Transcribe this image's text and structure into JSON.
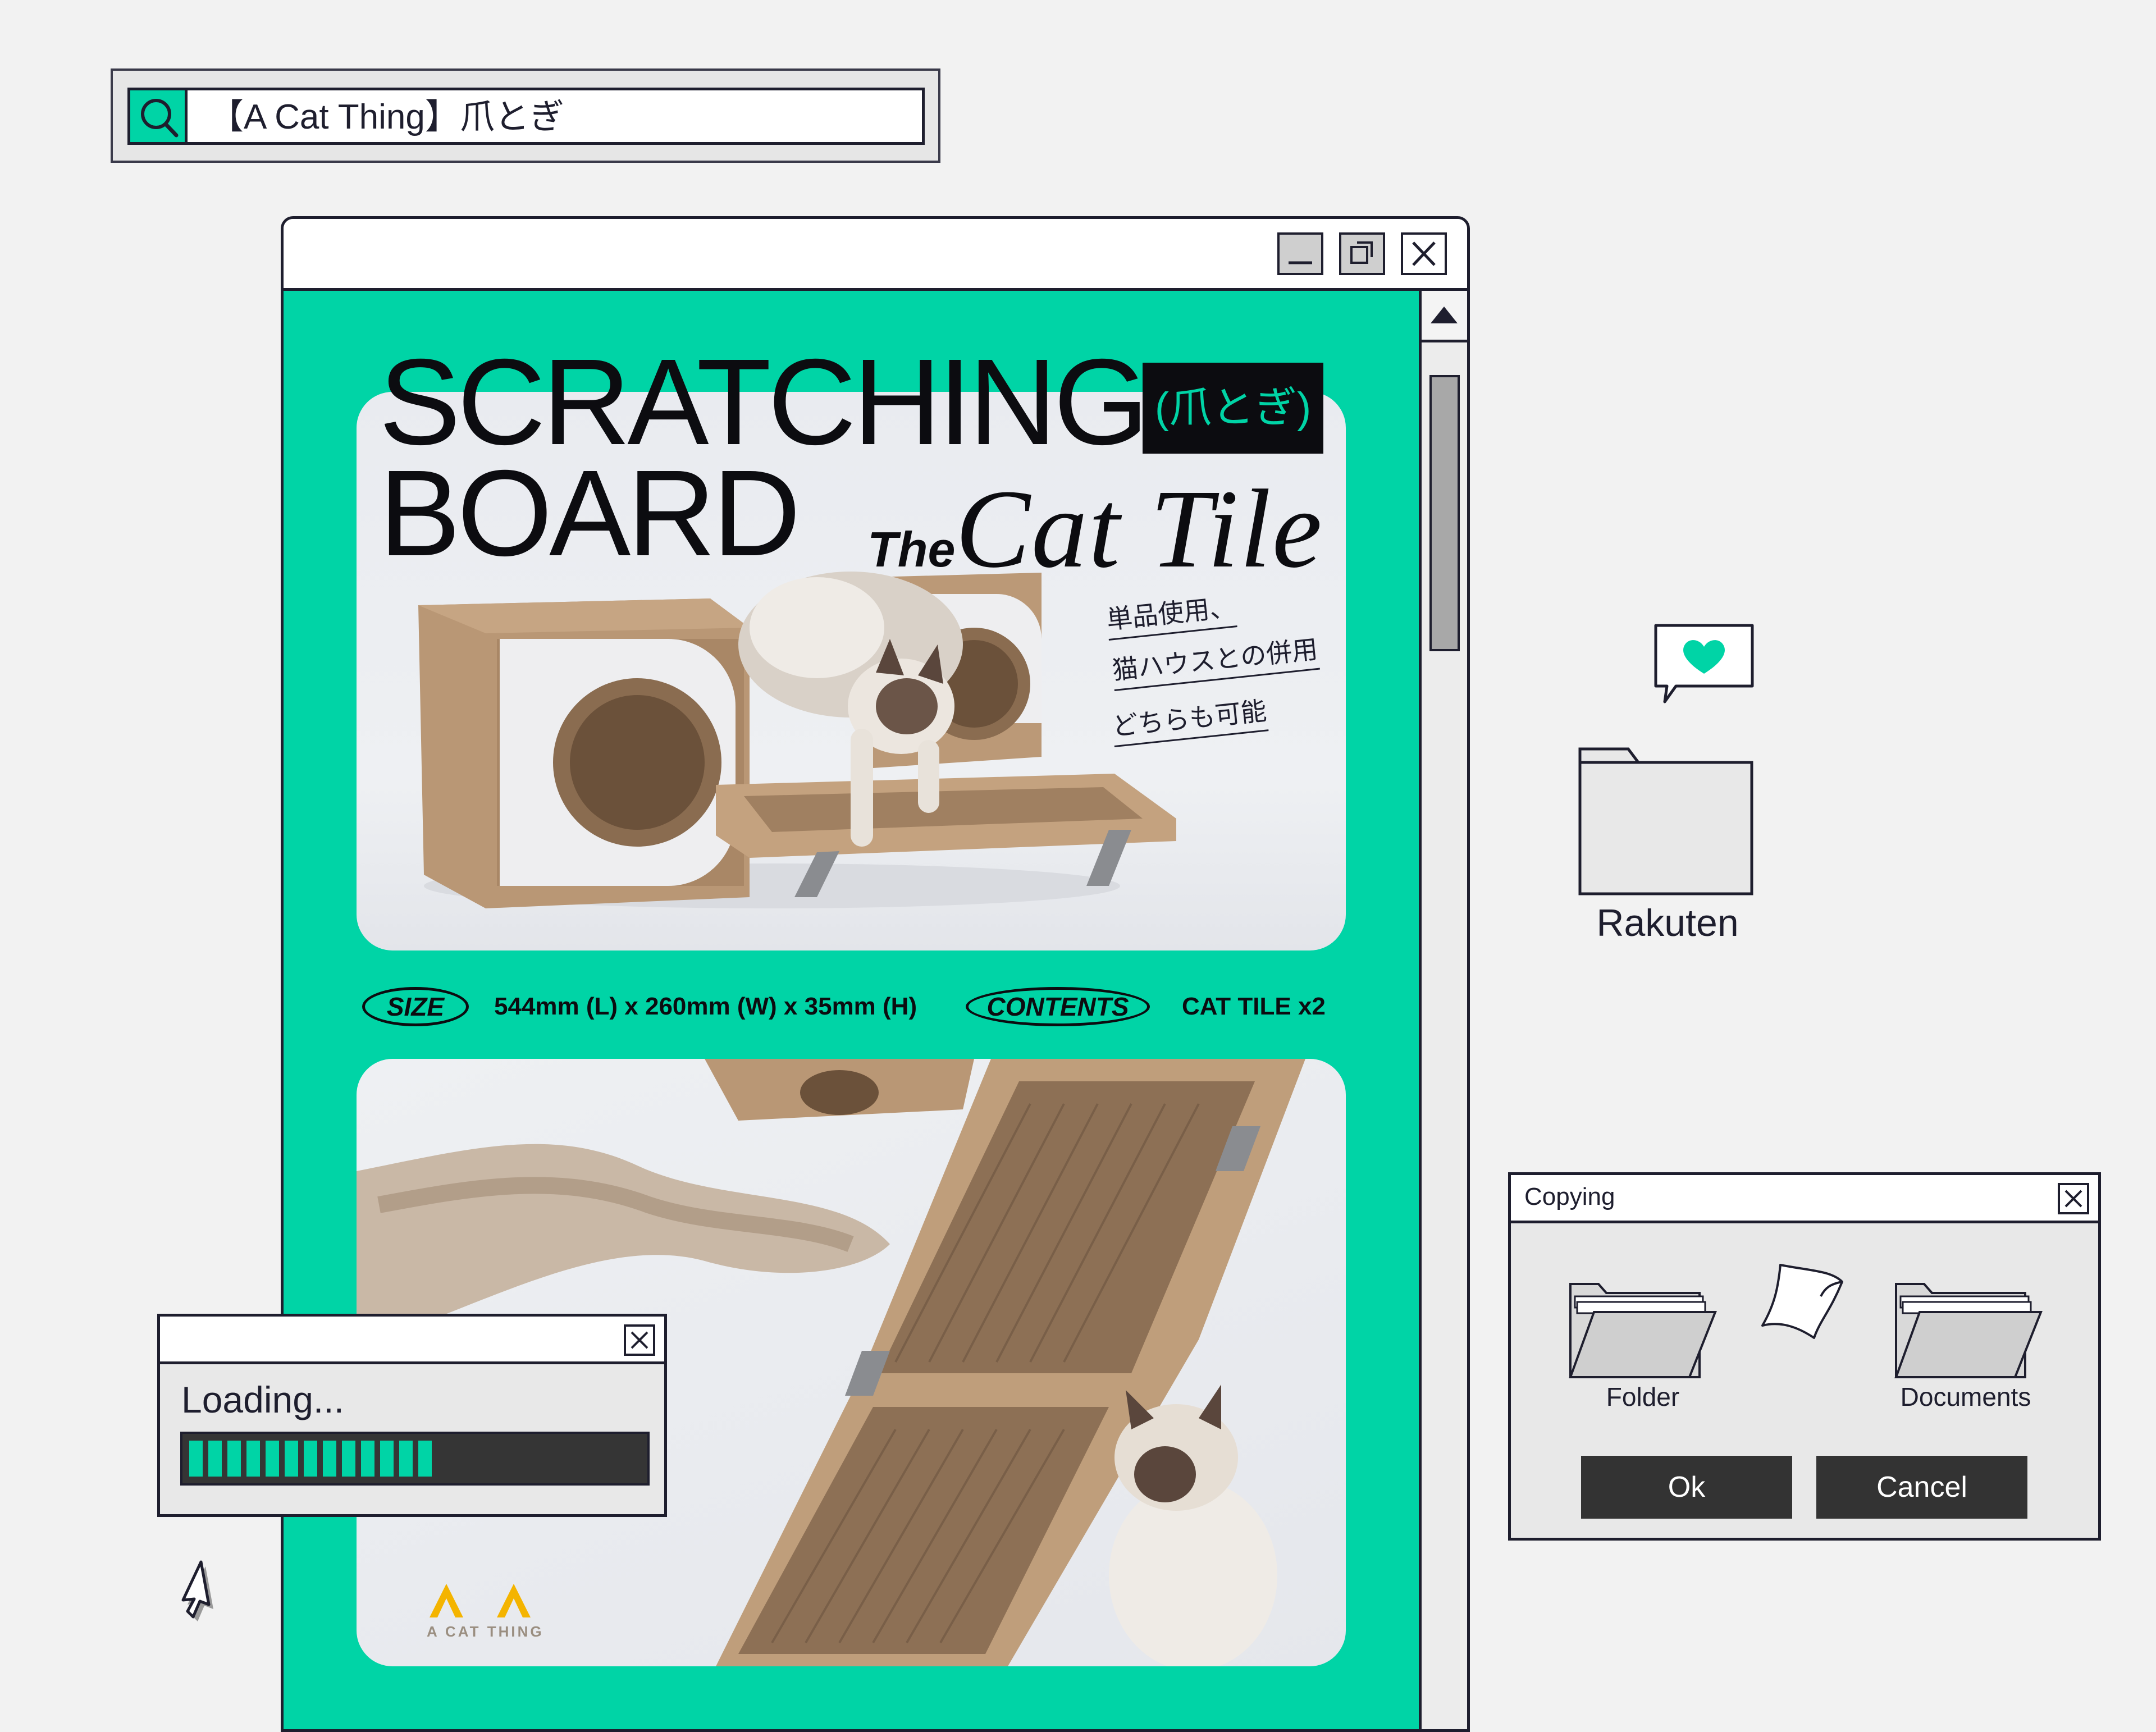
{
  "search": {
    "query": "【A Cat Thing】爪とぎ",
    "icon": "search-icon",
    "accent": "#00d4a6"
  },
  "main_window": {
    "controls": [
      "minimize-icon",
      "restore-icon",
      "close-icon"
    ],
    "background": "#00d4a6",
    "headline": {
      "line1": "SCRATCHING",
      "line2": "BOARD",
      "jp_tag": "(爪とぎ)",
      "the": "The",
      "product_name": "Cat Tile"
    },
    "jp_notes": [
      "単品使用、",
      "猫ハウスとの併用",
      "どちらも可能"
    ],
    "specs": {
      "size_label": "SIZE",
      "size_value": "544mm (L) x 260mm (W) x 35mm (H)",
      "contents_label": "CONTENTS",
      "contents_value": "CAT TILE x2"
    },
    "logo_text": "A CAT THING"
  },
  "loading_window": {
    "title_close": "close-icon",
    "text": "Loading...",
    "progress_segments_filled": 13,
    "progress_bar_color": "#00d4a6"
  },
  "desktop": {
    "chat_icon": "heart-chat-icon",
    "folder_label": "Rakuten"
  },
  "copy_dialog": {
    "title": "Copying",
    "source_label": "Folder",
    "target_label": "Documents",
    "ok_label": "Ok",
    "cancel_label": "Cancel"
  }
}
